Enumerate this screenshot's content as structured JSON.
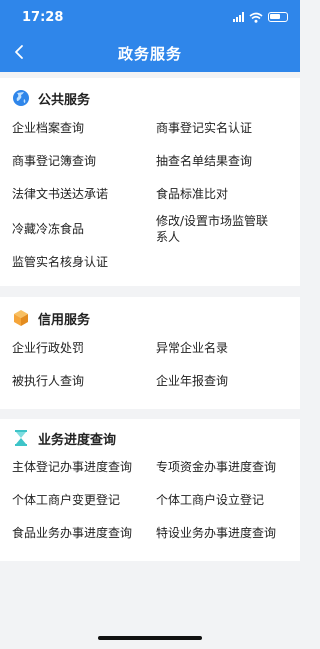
{
  "status": {
    "time": "17:28"
  },
  "nav": {
    "title": "政务服务"
  },
  "sections": [
    {
      "title": "公共服务",
      "icon": "globe-icon",
      "items": [
        "企业档案查询",
        "商事登记实名认证",
        "商事登记簿查询",
        "抽查名单结果查询",
        "法律文书送达承诺",
        "食品标准比对",
        "冷藏冷冻食品",
        "修改/设置市场监管联系人",
        "监管实名核身认证"
      ]
    },
    {
      "title": "信用服务",
      "icon": "cube-icon",
      "items": [
        "企业行政处罚",
        "异常企业名录",
        "被执行人查询",
        "企业年报查询"
      ]
    },
    {
      "title": "业务进度查询",
      "icon": "hourglass-icon",
      "items": [
        "主体登记办事进度查询",
        "专项资金办事进度查询",
        "个体工商户变更登记",
        "个体工商户设立登记",
        "食品业务办事进度查询",
        "特设业务办事进度查询"
      ]
    }
  ],
  "colors": {
    "header": "#2f86ea",
    "background": "#f2f3f5",
    "globe": "#2f86ea",
    "cube": "#f5a53a",
    "hourglass": "#3ec4c8"
  }
}
